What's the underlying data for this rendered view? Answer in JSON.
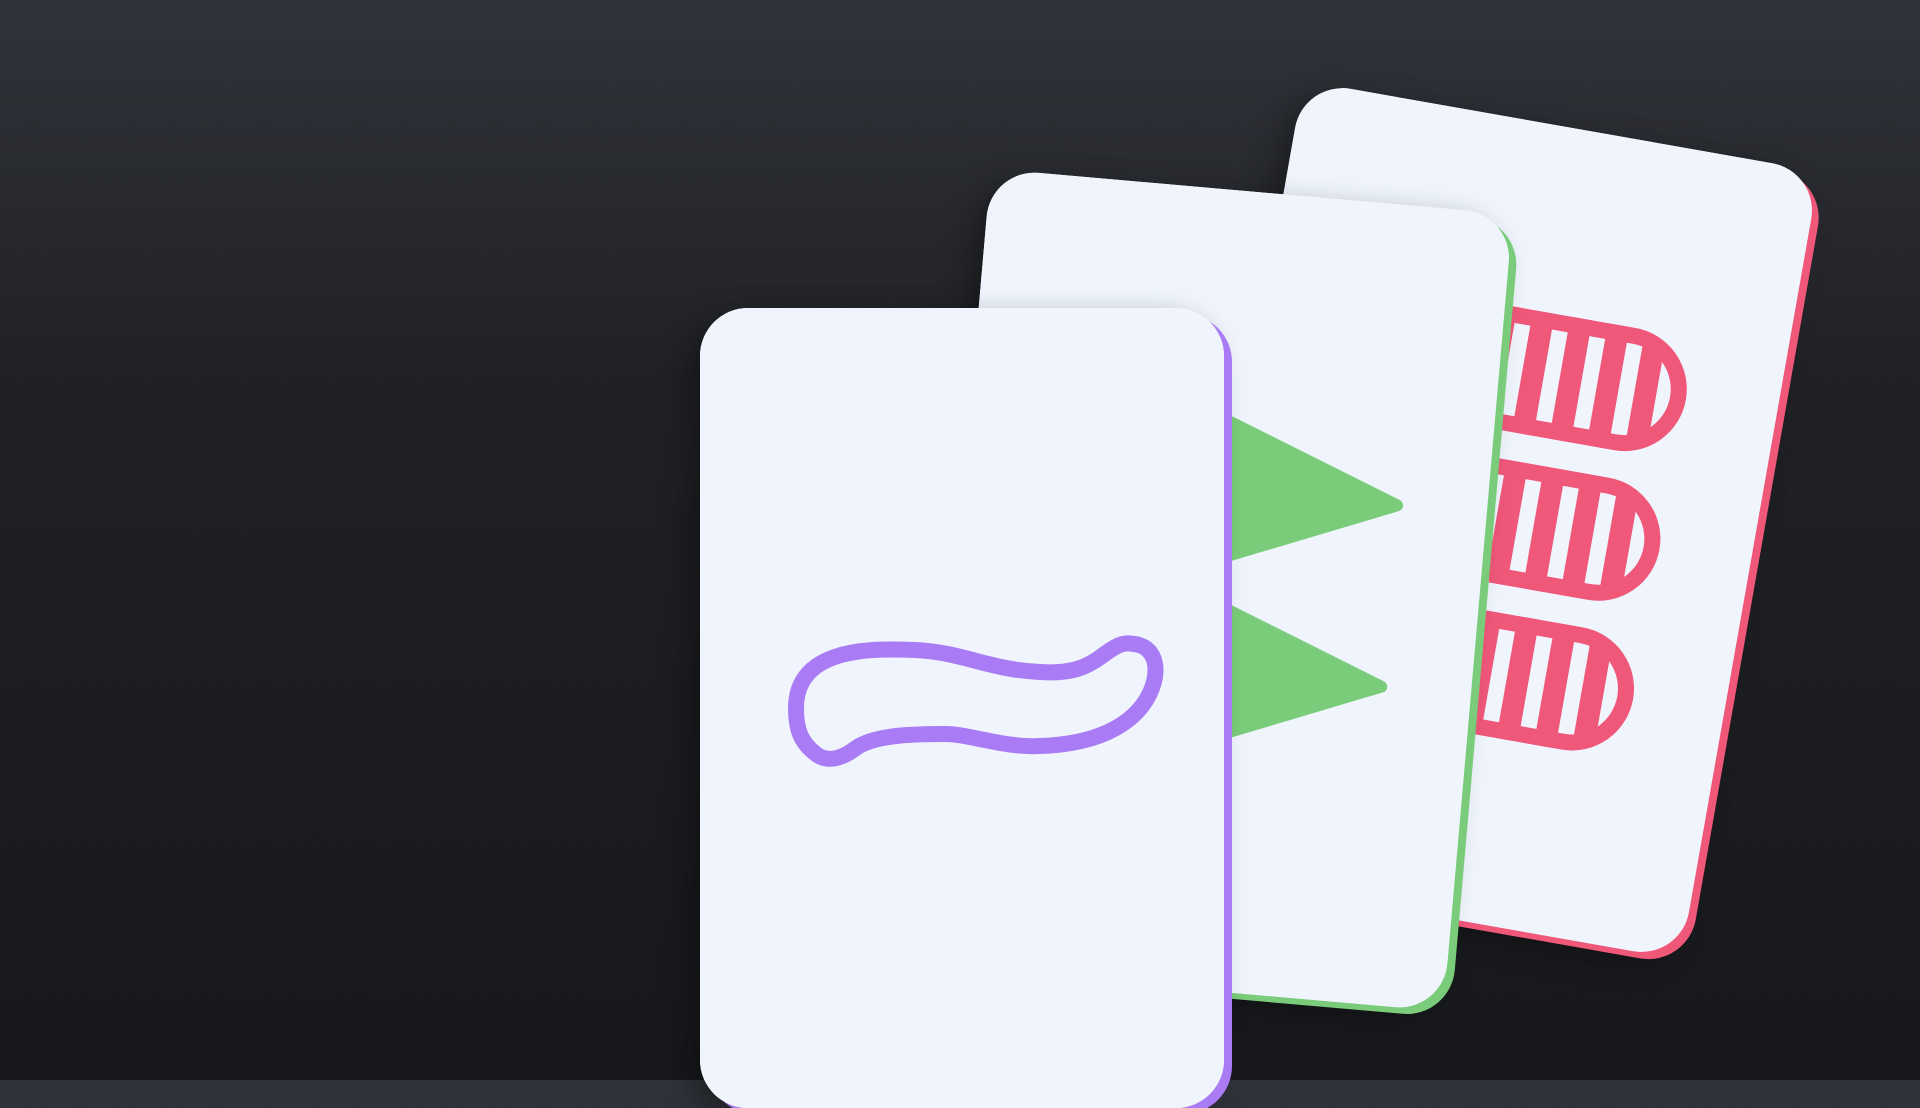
{
  "colors": {
    "background_top": "#30333a",
    "background_bottom": "#17181b",
    "card_face": "#f0f5fd"
  },
  "cards": [
    {
      "id": "card-red",
      "color_name": "red",
      "color": "#f0587a",
      "shape": "oval-icon",
      "count": 3,
      "shading": "striped"
    },
    {
      "id": "card-green",
      "color_name": "green",
      "color": "#7acc7a",
      "shape": "diamond-icon",
      "count": 2,
      "shading": "solid"
    },
    {
      "id": "card-purple",
      "color_name": "purple",
      "color": "#a97bf5",
      "shape": "squiggle-icon",
      "count": 1,
      "shading": "open"
    }
  ]
}
